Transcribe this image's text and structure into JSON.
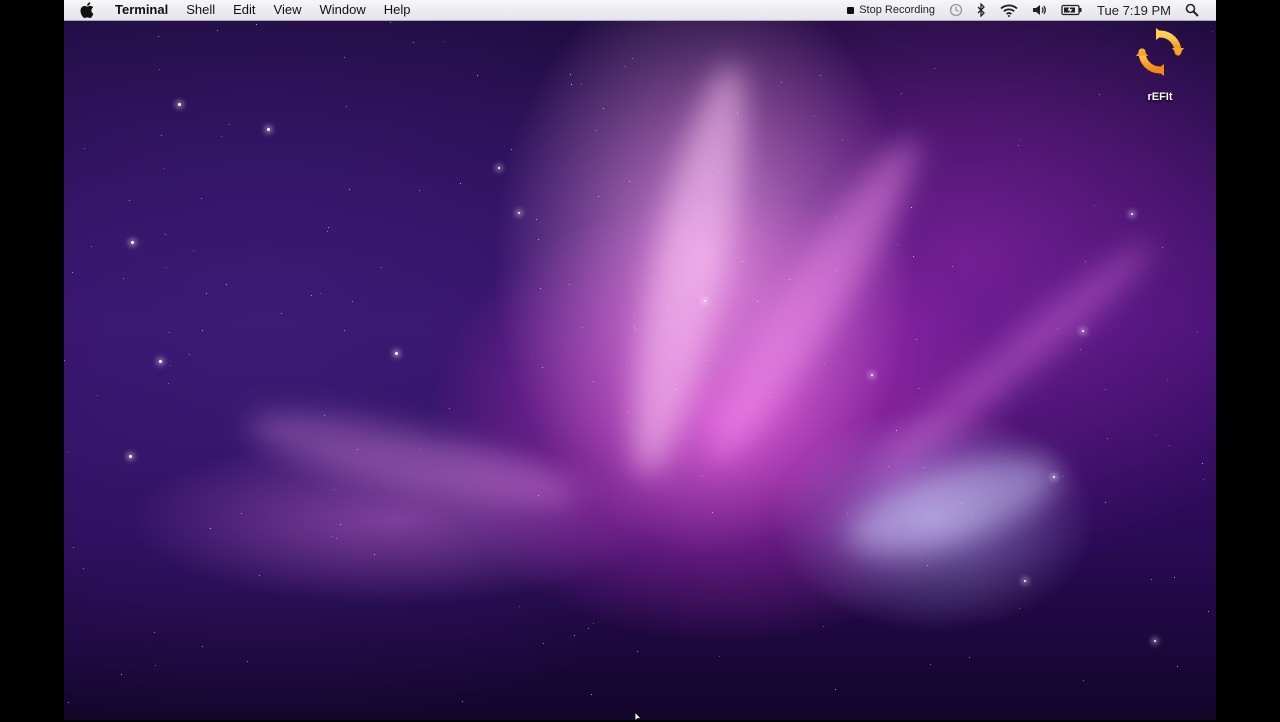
{
  "menubar": {
    "apple_icon": "apple-logo-icon",
    "app_name": "Terminal",
    "menus": [
      "Shell",
      "Edit",
      "View",
      "Window",
      "Help"
    ],
    "status": {
      "stop_recording_label": "Stop Recording",
      "clock": "Tue 7:19 PM",
      "icons": [
        "stop-square-icon",
        "time-machine-icon",
        "bluetooth-icon",
        "wifi-icon",
        "volume-icon",
        "battery-icon",
        "spotlight-search-icon"
      ]
    }
  },
  "desktop": {
    "icons": [
      {
        "label": "rEFIt",
        "icon": "refit-icon",
        "color": "#f5a623"
      }
    ]
  },
  "colors": {
    "menubar_bg": "#ececf0",
    "wallpaper_primary": "#d13ad6",
    "wallpaper_dark": "#1b0b3a"
  }
}
